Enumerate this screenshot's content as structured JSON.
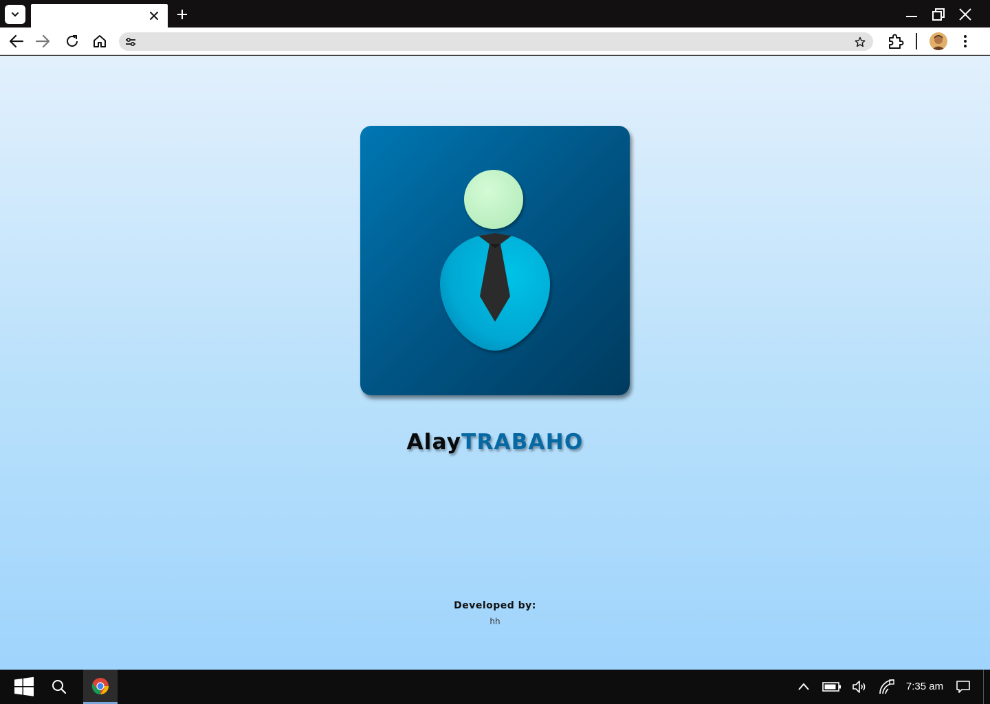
{
  "browser": {
    "tab": {
      "title": ""
    },
    "address": {
      "value": "",
      "placeholder": ""
    }
  },
  "app": {
    "title_part1": "Alay",
    "title_part2": "TRABAHO",
    "developed_label": "Developed by:",
    "developer": "hh",
    "colors": {
      "card_top": "#0077b3",
      "card_bottom": "#003b5f",
      "head": "#c5f5c9",
      "body": "#00b0d8",
      "tie": "#2b2b2b",
      "title_accent": "#0669a3"
    }
  },
  "taskbar": {
    "clock": "7:35 am"
  }
}
